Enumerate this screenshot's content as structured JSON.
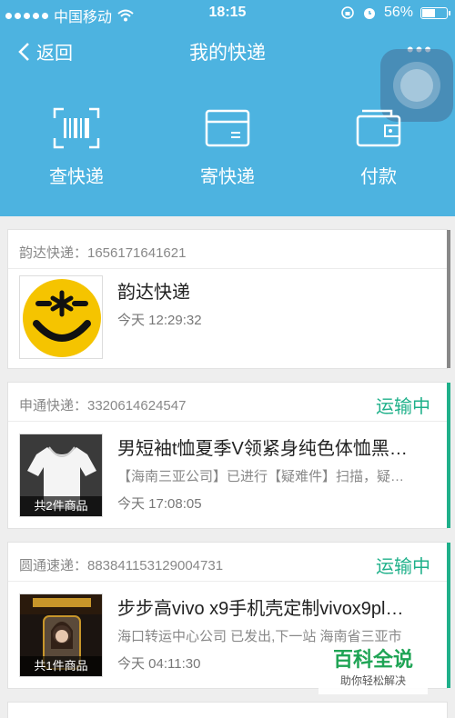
{
  "status_bar": {
    "carrier": "中国移动",
    "time": "18:15",
    "battery": "56%",
    "battery_level": 0.56
  },
  "nav": {
    "back": "返回",
    "title": "我的快递",
    "more": "•••"
  },
  "actions": [
    {
      "label": "查快递",
      "icon": "barcode-scan-icon"
    },
    {
      "label": "寄快递",
      "icon": "box-icon"
    },
    {
      "label": "付款",
      "icon": "wallet-icon"
    }
  ],
  "packages": [
    {
      "header": "韵达快递：1656171641621",
      "status": "",
      "title": "韵达快递",
      "desc": "",
      "time": "今天 12:29:32",
      "badge": "",
      "accent": "#888888"
    },
    {
      "header": "申通快递：3320614624547",
      "status": "运输中",
      "title": "男短袖t恤夏季V领紧身纯色体恤黑…",
      "desc": "【海南三亚公司】已进行【疑难件】扫描，疑…",
      "time": "今天 17:08:05",
      "badge": "共2件商品",
      "accent": "#1fb08a"
    },
    {
      "header": "圆通速递：883841153129004731",
      "status": "运输中",
      "title": "步步高vivo x9手机壳定制vivox9pl…",
      "desc": "海口转运中心公司 已发出,下一站 海南省三亚市",
      "time": "今天 04:11:30",
      "badge": "共1件商品",
      "accent": "#1fb08a"
    }
  ],
  "watermark": {
    "title": "百科全说",
    "subtitle": "助你轻松解决"
  }
}
